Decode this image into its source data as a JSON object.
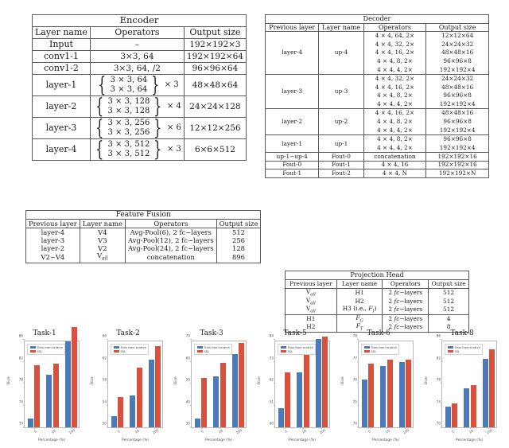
{
  "encoder": {
    "title": "Encoder",
    "headers": [
      "Layer name",
      "Operators",
      "Output size"
    ],
    "rows": [
      {
        "name": "Input",
        "op_plain": "–",
        "out": "192×192×3"
      },
      {
        "name": "conv1-1",
        "op_plain": "3×3, 64",
        "out": "192×192×64"
      },
      {
        "name": "conv1-2",
        "op_plain": "3×3, 64, /2",
        "out": "96×96×64"
      },
      {
        "name": "layer-1",
        "op_top": "3 × 3, 64",
        "op_bot": "3 × 3, 64",
        "mult": "× 3",
        "out": "48×48×64"
      },
      {
        "name": "layer-2",
        "op_top": "3 × 3, 128",
        "op_bot": "3 × 3, 128",
        "mult": "× 4",
        "out": "24×24×128"
      },
      {
        "name": "layer-3",
        "op_top": "3 × 3, 256",
        "op_bot": "3 × 3, 256",
        "mult": "× 6",
        "out": "12×12×256"
      },
      {
        "name": "layer-4",
        "op_top": "3 × 3, 512",
        "op_bot": "3 × 3, 512",
        "mult": "× 3",
        "out": "6×6×512"
      }
    ]
  },
  "fusion": {
    "title": "Feature Fusion",
    "headers": [
      "Previous layer",
      "Layer name",
      "Operators",
      "Output size"
    ],
    "rows": [
      {
        "prev": "layer-4",
        "name": "V4",
        "op": "Avg-Pool(6), 2 fc−layers",
        "out": "512"
      },
      {
        "prev": "layer-3",
        "name": "V3",
        "op": "Avg-Pool(12), 2 fc−layers",
        "out": "256"
      },
      {
        "prev": "layer-2",
        "name": "V2",
        "op": "Avg-Pool(24), 2 fc−layers",
        "out": "128"
      },
      {
        "prev": "V2∼V4",
        "name": "Vall",
        "op": "concatenation",
        "out": "896"
      }
    ]
  },
  "decoder": {
    "title": "Decoder",
    "headers": [
      "Previous layer",
      "Layer name",
      "Operators",
      "Output size"
    ],
    "rows": [
      {
        "prev": "layer-4",
        "name": "up-4",
        "ops": [
          "4 × 4, 64, 2×",
          "4 × 4, 32, 2×",
          "4 × 4, 16, 2×",
          "4 × 4, 8, 2×",
          "4 × 4, 4, 2×"
        ],
        "outs": [
          "12×12×64",
          "24×24×32",
          "48×48×16",
          "96×96×8",
          "192×192×4"
        ]
      },
      {
        "prev": "layer-3",
        "name": "up-3",
        "ops": [
          "4 × 4, 32, 2×",
          "4 × 4, 16, 2×",
          "4 × 4, 8, 2×",
          "4 × 4, 4, 2×"
        ],
        "outs": [
          "24×24×32",
          "48×48×16",
          "96×96×8",
          "192×192×4"
        ]
      },
      {
        "prev": "layer-2",
        "name": "up-2",
        "ops": [
          "4 × 4, 16, 2×",
          "4 × 4, 8, 2×",
          "4 × 4, 4, 2×"
        ],
        "outs": [
          "48×48×16",
          "96×96×8",
          "192×192×4"
        ]
      },
      {
        "prev": "layer-1",
        "name": "up-1",
        "ops": [
          "4 × 4, 8, 2×",
          "4 × 4, 4, 2×"
        ],
        "outs": [
          "96×96×8",
          "192×192×4"
        ]
      },
      {
        "prev": "up-1∼up-4",
        "name": "Fout-0",
        "ops": [
          "concatenation"
        ],
        "outs": [
          "192×192×16"
        ]
      },
      {
        "prev": "Fout-0",
        "name": "Fout-1",
        "ops": [
          "4 × 4, 16"
        ],
        "outs": [
          "192×192×16"
        ]
      },
      {
        "prev": "Fout-1",
        "name": "Fout-2",
        "ops": [
          "4 × 4, N"
        ],
        "outs": [
          "192×192×N"
        ]
      }
    ]
  },
  "projection": {
    "title": "Projection Head",
    "headers": [
      "Previous layer",
      "Layer name",
      "Operators",
      "Output size"
    ],
    "rows": [
      {
        "prev": "Vall",
        "name": "H1",
        "op": "2 fc−layers",
        "out": "512"
      },
      {
        "prev": "Vall",
        "name": "H2",
        "op": "2 fc−layers",
        "out": "512"
      },
      {
        "prev": "Vall",
        "name": "H3 (i.e., FI)",
        "op": "2 fc−layers",
        "out": "512"
      },
      {
        "prev": "H1",
        "name": "FG",
        "op": "2 fc−layers",
        "out": "4"
      },
      {
        "prev": "H2",
        "name": "FT",
        "op": "2 fc−layers",
        "out": "8"
      }
    ]
  },
  "colors": {
    "scratch": "#4c79b8",
    "ssl": "#d9503c",
    "axis": "#b9b9b9",
    "text": "#4d4d4d"
  },
  "chart_data": [
    {
      "type": "bar",
      "title": "Task-1",
      "xlabel": "Percentage (%)",
      "ylabel": "Dice",
      "categories": [
        "5",
        "10",
        "100"
      ],
      "yticks": [
        70,
        74,
        78,
        82,
        86
      ],
      "ylim": [
        70,
        86
      ],
      "grid": false,
      "legend": [
        "Train from scratch",
        "SSL"
      ],
      "legend_position": "upper left",
      "series": [
        {
          "name": "Train from scratch",
          "values": [
            71.6,
            79.6,
            85.7
          ]
        },
        {
          "name": "SSL",
          "values": [
            81.4,
            81.7,
            88.4
          ]
        }
      ]
    },
    {
      "type": "bar",
      "title": "Task-2",
      "xlabel": "Percentage (%)",
      "ylabel": "Dice",
      "categories": [
        "5",
        "10",
        "100"
      ],
      "yticks": [
        50,
        54,
        58,
        62,
        66
      ],
      "ylim": [
        50,
        66
      ],
      "grid": false,
      "legend": [
        "Train from scratch",
        "SSL"
      ],
      "legend_position": "upper left",
      "series": [
        {
          "name": "Train from scratch",
          "values": [
            52.0,
            55.8,
            62.4
          ]
        },
        {
          "name": "SSL",
          "values": [
            55.5,
            60.9,
            64.8
          ]
        }
      ]
    },
    {
      "type": "bar",
      "title": "Task-3",
      "xlabel": "Percentage (%)",
      "ylabel": "Dice",
      "categories": [
        "5",
        "10",
        "100"
      ],
      "yticks": [
        30,
        40,
        50,
        60,
        70
      ],
      "ylim": [
        30,
        70
      ],
      "grid": false,
      "legend": [
        "Train from scratch",
        "SSL"
      ],
      "legend_position": "upper left",
      "series": [
        {
          "name": "Train from scratch",
          "values": [
            34.0,
            53.4,
            63.4
          ]
        },
        {
          "name": "SSL",
          "values": [
            52.6,
            59.5,
            68.5
          ]
        }
      ]
    },
    {
      "type": "bar",
      "title": "Task-5",
      "xlabel": "Percentage (%)",
      "ylabel": "Dice",
      "categories": [
        "5",
        "10",
        "100"
      ],
      "yticks": [
        40,
        51,
        62,
        73,
        84
      ],
      "ylim": [
        40,
        84
      ],
      "grid": false,
      "legend": [
        "Train from scratch",
        "SSL"
      ],
      "legend_position": "upper left",
      "series": [
        {
          "name": "Train from scratch",
          "values": [
            49.6,
            67.5,
            84.6
          ]
        },
        {
          "name": "SSL",
          "values": [
            67.5,
            80.6,
            85.6
          ]
        }
      ]
    },
    {
      "type": "bar",
      "title": "Task-6",
      "xlabel": "Percentage (%)",
      "ylabel": "Dice",
      "categories": [
        "5",
        "10",
        "100"
      ],
      "yticks": [
        74,
        75,
        76,
        77,
        78
      ],
      "ylim": [
        74,
        78
      ],
      "grid": false,
      "legend": [
        "Train from scratch",
        "SSL"
      ],
      "legend_position": "upper left",
      "series": [
        {
          "name": "Train from scratch",
          "values": [
            76.2,
            76.8,
            77.0
          ]
        },
        {
          "name": "SSL",
          "values": [
            76.9,
            77.1,
            77.1
          ]
        }
      ]
    },
    {
      "type": "bar",
      "title": "Task-8",
      "xlabel": "Percentage (%)",
      "ylabel": "Dice",
      "categories": [
        "5",
        "10",
        "100"
      ],
      "yticks": [
        70,
        74,
        78,
        82,
        86
      ],
      "ylim": [
        70,
        86
      ],
      "grid": false,
      "legend": [
        "Train from scratch",
        "SSL"
      ],
      "legend_position": "upper left",
      "series": [
        {
          "name": "Train from scratch",
          "values": [
            73.8,
            77.2,
            82.5
          ]
        },
        {
          "name": "SSL",
          "values": [
            74.4,
            77.7,
            84.3
          ]
        }
      ]
    }
  ]
}
